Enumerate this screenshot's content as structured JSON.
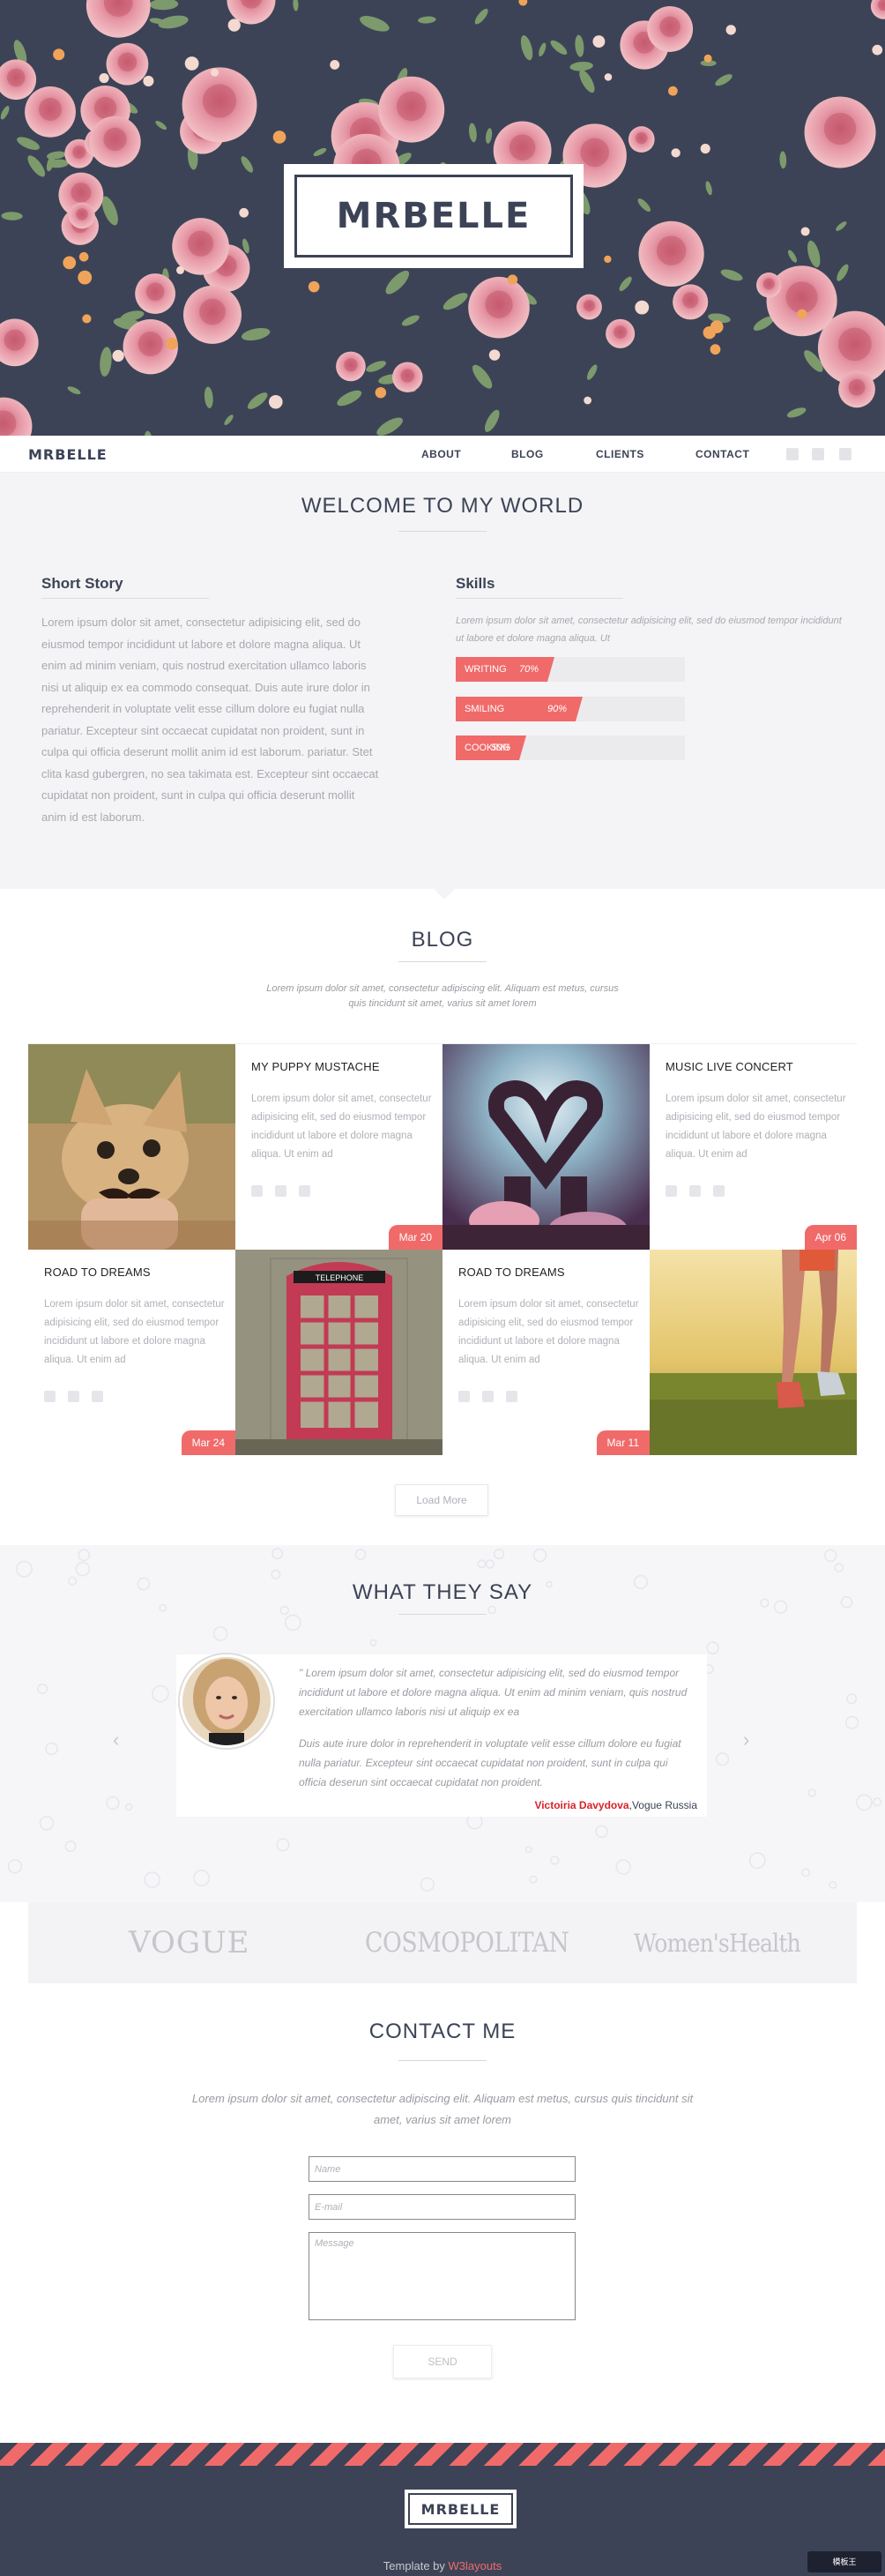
{
  "hero": {
    "logo_text": "MRBELLE"
  },
  "nav": {
    "brand": "MRBELLE",
    "links": [
      "ABOUT",
      "BLOG",
      "CLIENTS",
      "CONTACT"
    ],
    "social_icons": [
      "instagram-icon",
      "twitter-icon",
      "facebook-icon"
    ]
  },
  "welcome": {
    "title": "WELCOME TO MY WORLD",
    "story_heading": "Short Story",
    "story_text": "Lorem ipsum dolor sit amet, consectetur adipisicing elit, sed do eiusmod tempor incididunt ut labore et dolore magna aliqua. Ut enim ad minim veniam, quis nostrud exercitation ullamco laboris nisi ut aliquip ex ea commodo consequat. Duis aute irure dolor in reprehenderit in voluptate velit esse cillum dolore eu fugiat nulla pariatur. Excepteur sint occaecat cupidatat non proident, sunt in culpa qui officia deserunt mollit anim id est laborum. pariatur. Stet clita kasd gubergren, no sea takimata est. Excepteur sint occaecat cupidatat non proident, sunt in culpa qui officia deserunt mollit anim id est laborum.",
    "skills_heading": "Skills",
    "skills_text": "Lorem ipsum dolor sit amet, consectetur adipisicing elit, sed do eiusmod tempor incididunt ut labore et dolore magna aliqua. Ut",
    "skills": [
      {
        "label": "WRITING",
        "value": 70,
        "display": "70%"
      },
      {
        "label": "SMILING",
        "value": 90,
        "display": "90%"
      },
      {
        "label": "COOKING",
        "value": 50,
        "display": "50%"
      }
    ]
  },
  "blog": {
    "title": "BLOG",
    "subtitle": "Lorem ipsum dolor sit amet, consectetur adipiscing elit. Aliquam est metus, cursus quis tincidunt sit amet, varius sit amet lorem",
    "posts": [
      {
        "title": "MY PUPPY MUSTACHE",
        "text": "Lorem ipsum dolor sit amet, consectetur adipisicing elit, sed do eiusmod tempor incididunt ut labore et dolore magna aliqua. Ut enim ad",
        "date": "Mar 20"
      },
      {
        "title": "MUSIC LIVE CONCERT",
        "text": "Lorem ipsum dolor sit amet, consectetur adipisicing elit, sed do eiusmod tempor incididunt ut labore et dolore magna aliqua. Ut enim ad",
        "date": "Apr 06"
      },
      {
        "title": "ROAD TO DREAMS",
        "text": "Lorem ipsum dolor sit amet, consectetur adipisicing elit, sed do eiusmod tempor incididunt ut labore et dolore magna aliqua. Ut enim ad",
        "date": "Mar 24"
      },
      {
        "title": "ROAD TO DREAMS",
        "text": "Lorem ipsum dolor sit amet, consectetur adipisicing elit, sed do eiusmod tempor incididunt ut labore et dolore magna aliqua. Ut enim ad",
        "date": "Mar 11"
      }
    ],
    "phone_sign": "TELEPHONE",
    "load_more": "Load More"
  },
  "testimonial": {
    "title": "WHAT THEY SAY",
    "quote1": "\" Lorem ipsum dolor sit amet, consectetur adipisicing elit, sed do eiusmod tempor incididunt ut labore et dolore magna aliqua. Ut enim ad minim veniam, quis nostrud exercitation ullamco laboris nisi ut aliquip ex ea",
    "quote2": "Duis aute irure dolor in reprehenderit in voluptate velit esse cillum dolore eu fugiat nulla pariatur. Excepteur sint occaecat cupidatat non proident, sunt in culpa qui officia deserun sint occaecat cupidatat non proident.",
    "author_name": "Victoiria Davydova",
    "author_role": ",Vogue Russia",
    "prev": "‹",
    "next": "›"
  },
  "clients": [
    "VOGUE",
    "COSMOPOLITAN",
    "Women'sHealth"
  ],
  "contact": {
    "title": "CONTACT ME",
    "text": "Lorem ipsum dolor sit amet, consectetur adipiscing elit. Aliquam est metus, cursus quis tincidunt sit amet, varius sit amet lorem",
    "name_placeholder": "Name",
    "email_placeholder": "E-mail",
    "message_placeholder": "Message",
    "send": "SEND"
  },
  "footer": {
    "logo_text": "MRBELLE",
    "credit_prefix": "Template by ",
    "credit_link": "W3layouts",
    "watermark": "模板王"
  },
  "colors": {
    "navy": "#3c4356",
    "accent": "#f06a6a",
    "light_bg": "#f4f4f6"
  }
}
